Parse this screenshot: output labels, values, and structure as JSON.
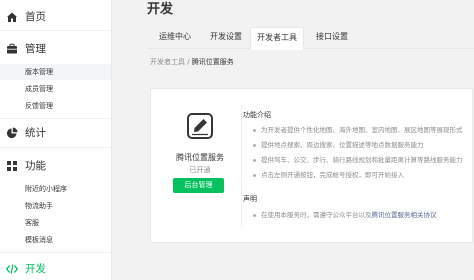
{
  "colors": {
    "accent": "#07c160",
    "link": "#576b95",
    "text": "#353535",
    "muted": "#8d8d8d"
  },
  "sidebar": {
    "home": {
      "label": "首页",
      "icon": "home-icon"
    },
    "manage": {
      "label": "管理",
      "icon": "briefcase-icon",
      "items": [
        {
          "label": "版本管理"
        },
        {
          "label": "成员管理"
        },
        {
          "label": "反馈管理"
        }
      ]
    },
    "stats": {
      "label": "统计",
      "icon": "pie-chart-icon"
    },
    "features": {
      "label": "功能",
      "icon": "grid-icon",
      "items": [
        {
          "label": "附近的小程序"
        },
        {
          "label": "物流助手"
        },
        {
          "label": "客服"
        },
        {
          "label": "模板消息"
        }
      ]
    },
    "dev": {
      "label": "开发",
      "icon": "code-icon"
    }
  },
  "main": {
    "title": "开发",
    "tabs": [
      {
        "label": "运维中心"
      },
      {
        "label": "开发设置"
      },
      {
        "label": "开发者工具"
      },
      {
        "label": "接口设置"
      }
    ],
    "breadcrumb": {
      "parent": "开发者工具",
      "separator": " / ",
      "current": "腾讯位置服务"
    }
  },
  "service": {
    "icon": "map-pen-icon",
    "name": "腾讯位置服务",
    "status": "已开通",
    "manage_button": "后台管理",
    "intro_title": "功能介绍",
    "features": [
      "为开发者提供个性化地图、海外地图、室内地图、展区地图等展现形式",
      "提供地点搜索、周边搜索、位置描述等地点数据服务能力",
      "提供驾车、公交、步行、骑行路线规划和批量距离计算等路线服务能力",
      "点击左侧开通按钮，完成帐号授权，即可开始接入"
    ],
    "notice_title": "声明",
    "notice_text": "在使用本服务时，需遵守公众平台以及",
    "notice_link": "腾讯位置服务相关协议"
  }
}
